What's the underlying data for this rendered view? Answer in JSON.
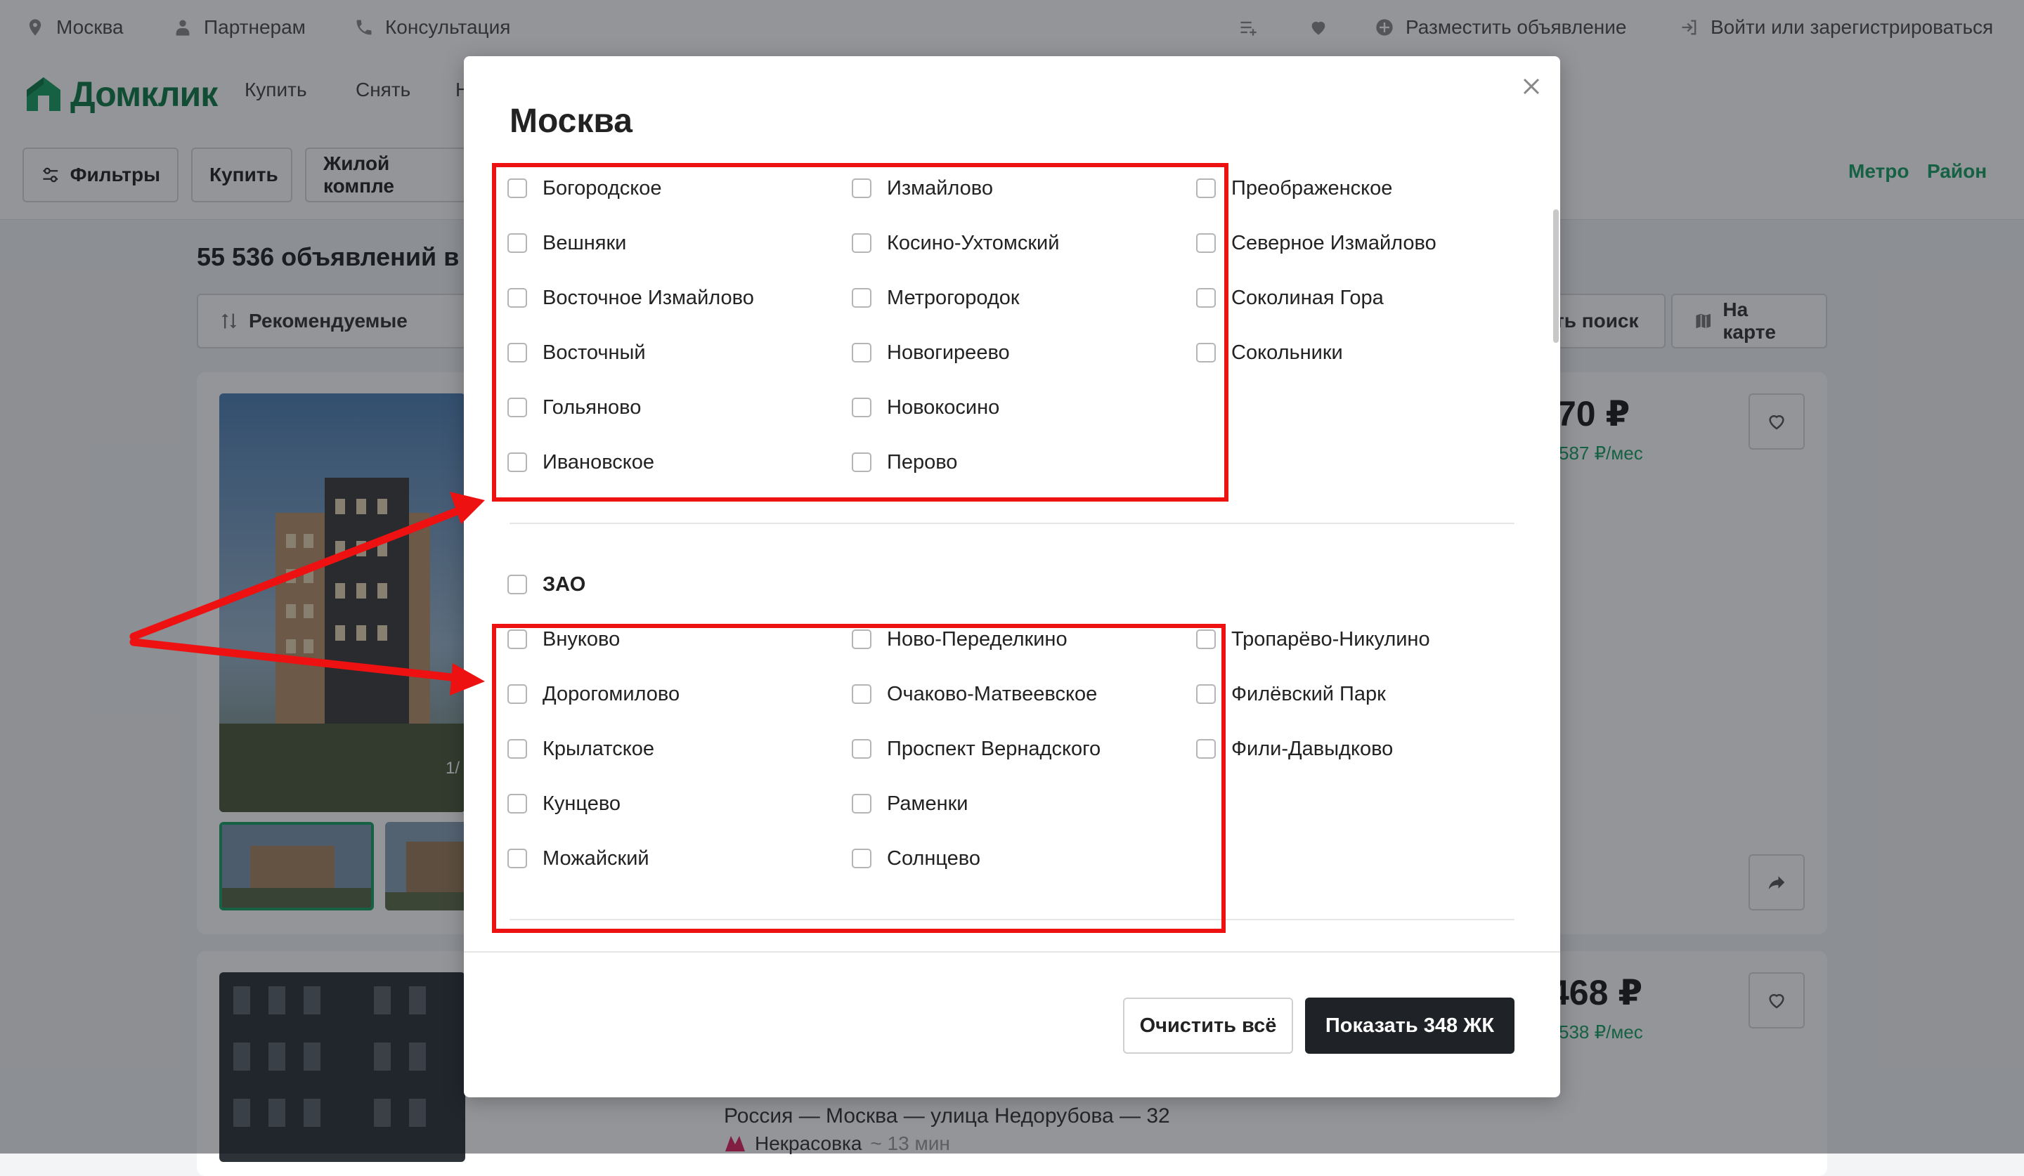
{
  "topbar": {
    "city": "Москва",
    "partners": "Партнерам",
    "consult": "Консультация",
    "post_ad": "Разместить объявление",
    "login": "Войти или зарегистрироваться"
  },
  "nav": {
    "logo": "Домклик",
    "links": [
      "Купить",
      "Снять",
      "Н"
    ]
  },
  "filters": {
    "filters_label": "Фильтры",
    "buy_label": "Купить",
    "type_label": "Жилой компле",
    "metro_label": "Метро",
    "district_label": "Район"
  },
  "results": {
    "title": "55 536 объявлений в З",
    "sort_label": "Рекомендуемые",
    "save_search_label": "ть поиск",
    "map_label": "На карте"
  },
  "cards": [
    {
      "price": "70 ₽",
      "monthly": "587 ₽/мес",
      "photo_counter": "1/"
    },
    {
      "price": "468 ₽",
      "monthly": "538 ₽/мес",
      "address": "Россия — Москва — улица Недорубова — 32",
      "metro": "Некрасовка",
      "walk": "~ 13 мин"
    }
  ],
  "modal": {
    "title": "Москва",
    "group1": {
      "col1": [
        "Богородское",
        "Вешняки",
        "Восточное Измайлово",
        "Восточный",
        "Гольяново",
        "Ивановское"
      ],
      "col2": [
        "Измайлово",
        "Косино-Ухтомский",
        "Метрогородок",
        "Новогиреево",
        "Новокосино",
        "Перово"
      ],
      "col3": [
        "Преображенское",
        "Северное Измайлово",
        "Соколиная Гора",
        "Сокольники"
      ]
    },
    "group2": {
      "title": "ЗАО",
      "col1": [
        "Внуково",
        "Дорогомилово",
        "Крылатское",
        "Кунцево",
        "Можайский"
      ],
      "col2": [
        "Ново-Переделкино",
        "Очаково-Матвеевское",
        "Проспект Вернадского",
        "Раменки",
        "Солнцево"
      ],
      "col3": [
        "Тропарёво-Никулино",
        "Филёвский Парк",
        "Фили-Давыдково"
      ]
    },
    "clear_label": "Очистить всё",
    "show_label": "Показать 348 ЖК"
  },
  "colors": {
    "accent": "#19a063",
    "highlight": "#ee1111",
    "primary_button": "#1f2327"
  }
}
